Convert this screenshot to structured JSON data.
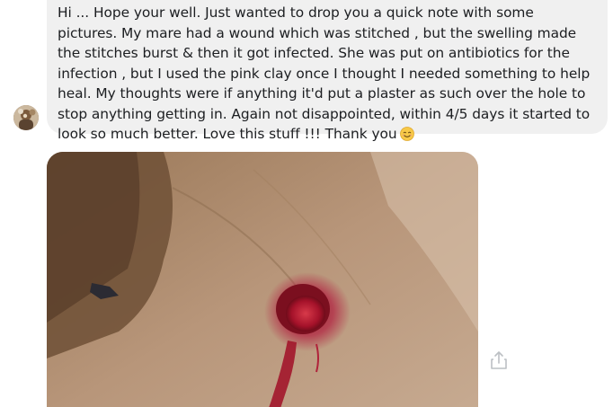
{
  "conversation": {
    "message": {
      "text": "Hi ... Hope your well. Just wanted to drop you a quick note with some pictures. My mare had a wound which was stitched , but the swelling made the stitches burst & then it got infected. She was put on antibiotics for the infection , but I used the pink clay once I thought I needed something to help heal. My thoughts were if anything it'd put a plaster as such over the hole to stop anything getting in. Again not disappointed, within 4/5 days it started to look so much better. Love this stuff !!! Thank you",
      "emoji": "smiling-face-emoji"
    },
    "attachment": {
      "type": "photo"
    },
    "actions": {
      "share_icon": "share-icon"
    }
  },
  "colors": {
    "bubble_background": "#f0f0f0",
    "text": "#1c1e21",
    "icon": "#bcc0c4"
  }
}
